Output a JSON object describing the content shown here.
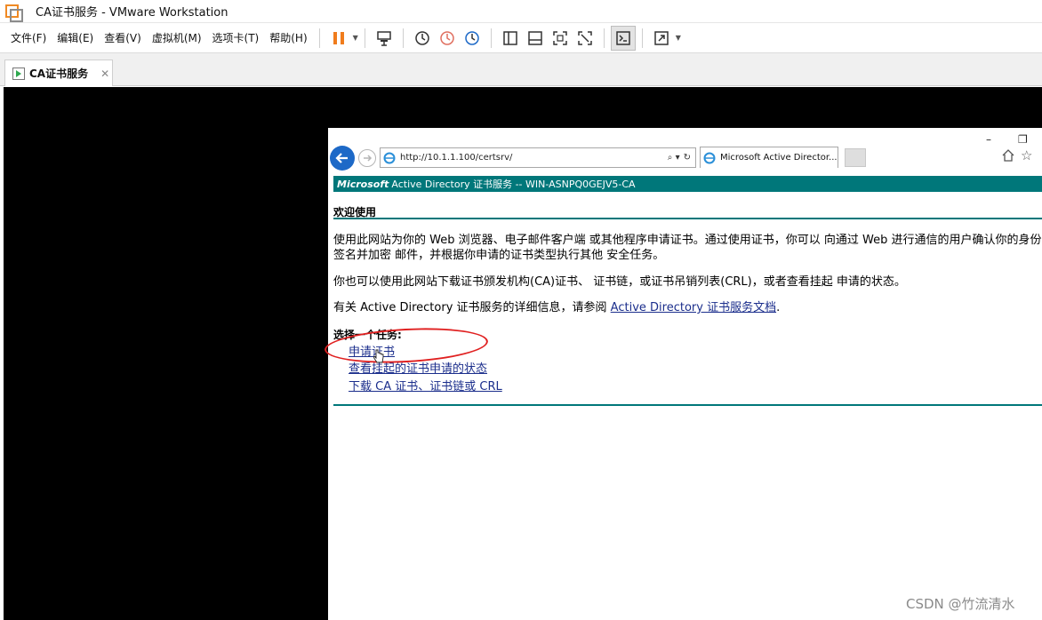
{
  "window": {
    "title": "CA证书服务 - VMware Workstation"
  },
  "menu": {
    "items": [
      "文件(F)",
      "编辑(E)",
      "查看(V)",
      "虚拟机(M)",
      "选项卡(T)",
      "帮助(H)"
    ]
  },
  "vm_tab": {
    "label": "CA证书服务",
    "close": "✕"
  },
  "ie": {
    "minimize": "–",
    "restore": "❐",
    "url": "http://10.1.1.100/certsrv/",
    "tab_label": "Microsoft Active Director...",
    "search_glyph": "⌕ ▾",
    "refresh_glyph": "↻"
  },
  "page": {
    "header_brand": "Microsoft",
    "header_title": "Active Directory 证书服务  --  WIN-ASNPQ0GEJV5-CA",
    "welcome": "欢迎使用",
    "para1_line1": "使用此网站为你的 Web 浏览器、电子邮件客户端 或其他程序申请证书。通过使用证书，你可以 向通过 Web 进行通信的用户确认你的身份",
    "para1_line2": "签名并加密 邮件，并根据你申请的证书类型执行其他 安全任务。",
    "para2": "你也可以使用此网站下载证书颁发机构(CA)证书、 证书链，或证书吊销列表(CRL)，或者查看挂起 申请的状态。",
    "para3_prefix": "有关 Active Directory 证书服务的详细信息，请参阅 ",
    "para3_link": "Active Directory 证书服务文档",
    "para3_suffix": ".",
    "choose_task": "选择一个任务:",
    "tasks": [
      "申请证书",
      "查看挂起的证书申请的状态",
      "下载 CA 证书、证书链或 CRL"
    ]
  },
  "watermark": "CSDN @竹流清水",
  "colors": {
    "header_teal": "#00777a",
    "link_blue": "#1b2e8c",
    "annotation_red": "#e02020",
    "ie_back_blue": "#1d69c7"
  }
}
